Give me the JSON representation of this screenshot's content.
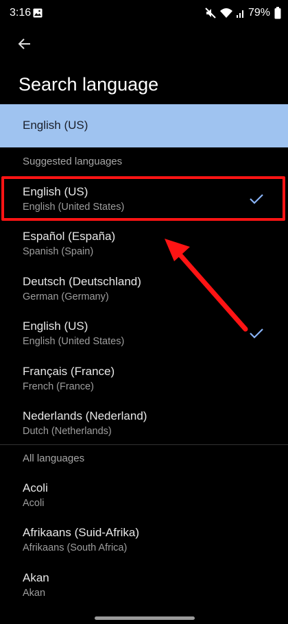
{
  "status_bar": {
    "time": "3:16",
    "battery": "79%"
  },
  "header": {
    "title": "Search language"
  },
  "current_selection": {
    "label": "English (US)"
  },
  "suggested": {
    "header": "Suggested languages",
    "items": [
      {
        "name": "English (US)",
        "sub": "English (United States)",
        "selected": true
      },
      {
        "name": "Español (España)",
        "sub": "Spanish (Spain)",
        "selected": false
      },
      {
        "name": "Deutsch (Deutschland)",
        "sub": "German (Germany)",
        "selected": false
      },
      {
        "name": "English (US)",
        "sub": "English (United States)",
        "selected": true
      },
      {
        "name": "Français (France)",
        "sub": "French (France)",
        "selected": false
      },
      {
        "name": "Nederlands (Nederland)",
        "sub": "Dutch (Netherlands)",
        "selected": false
      }
    ]
  },
  "all": {
    "header": "All languages",
    "items": [
      {
        "name": "Acoli",
        "sub": "Acoli"
      },
      {
        "name": "Afrikaans (Suid-Afrika)",
        "sub": "Afrikaans (South Africa)"
      },
      {
        "name": "Akan",
        "sub": "Akan"
      }
    ]
  },
  "colors": {
    "accent": "#9fc3f0",
    "check": "#8ab4f8",
    "annotation": "#ff1414"
  }
}
